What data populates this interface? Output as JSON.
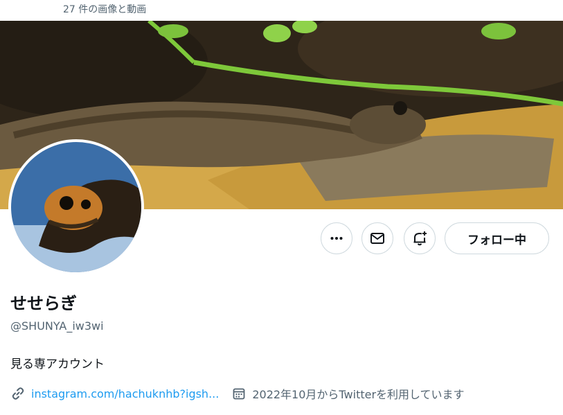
{
  "header": {
    "media_count": "27 件の画像と動画"
  },
  "profile": {
    "display_name": "せせらぎ",
    "handle": "@SHUNYA_iw3wi",
    "bio": "見る専アカウント",
    "link_text": "instagram.com/hachuknhb?igsh...",
    "joined_text": "2022年10月からTwitterを利用しています"
  },
  "actions": {
    "more_icon": "more-icon",
    "message_icon": "envelope-icon",
    "notify_icon": "bell-plus-icon",
    "follow_label": "フォロー中"
  },
  "icons": {
    "link": "link-icon",
    "calendar": "calendar-icon"
  },
  "colors": {
    "link": "#1d9bf0",
    "secondary_text": "#536471",
    "border": "#cfd9de",
    "primary_text": "#0f1419"
  }
}
